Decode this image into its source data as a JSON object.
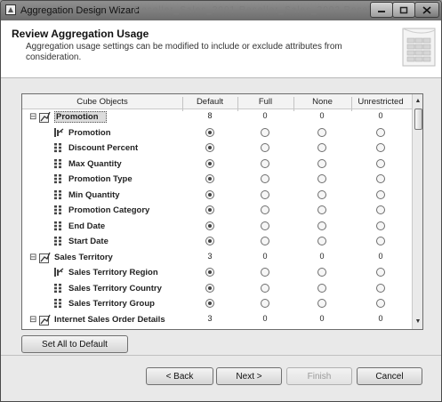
{
  "window": {
    "title": "Aggregation Design Wizard",
    "ghost_text": "Reseller_Sales_2001 Reseller_Sales_2002 Reseller_Sales_2003"
  },
  "header": {
    "title": "Review Aggregation Usage",
    "description": "Aggregation usage settings can be modified to include or exclude attributes from consideration."
  },
  "grid": {
    "columns": [
      "Cube Objects",
      "Default",
      "Full",
      "None",
      "Unrestricted"
    ],
    "rows": [
      {
        "label": "Promotion",
        "kind": "dimension",
        "values": [
          "8",
          "0",
          "0",
          "0"
        ]
      },
      {
        "label": "Promotion",
        "kind": "key",
        "selected": "Default"
      },
      {
        "label": "Discount Percent",
        "kind": "attribute",
        "selected": "Default"
      },
      {
        "label": "Max Quantity",
        "kind": "attribute",
        "selected": "Default"
      },
      {
        "label": "Promotion Type",
        "kind": "attribute",
        "selected": "Default"
      },
      {
        "label": "Min Quantity",
        "kind": "attribute",
        "selected": "Default"
      },
      {
        "label": "Promotion Category",
        "kind": "attribute",
        "selected": "Default"
      },
      {
        "label": "End Date",
        "kind": "attribute",
        "selected": "Default"
      },
      {
        "label": "Start Date",
        "kind": "attribute",
        "selected": "Default"
      },
      {
        "label": "Sales Territory",
        "kind": "dimension",
        "values": [
          "3",
          "0",
          "0",
          "0"
        ]
      },
      {
        "label": "Sales Territory Region",
        "kind": "key",
        "selected": "Default"
      },
      {
        "label": "Sales Territory Country",
        "kind": "attribute",
        "selected": "Default"
      },
      {
        "label": "Sales Territory Group",
        "kind": "attribute",
        "selected": "Default"
      },
      {
        "label": "Internet Sales Order Details",
        "kind": "dimension",
        "values": [
          "3",
          "0",
          "0",
          "0"
        ]
      }
    ]
  },
  "buttons": {
    "set_all": "Set All to Default",
    "back": "< Back",
    "next": "Next >",
    "finish": "Finish",
    "cancel": "Cancel"
  }
}
